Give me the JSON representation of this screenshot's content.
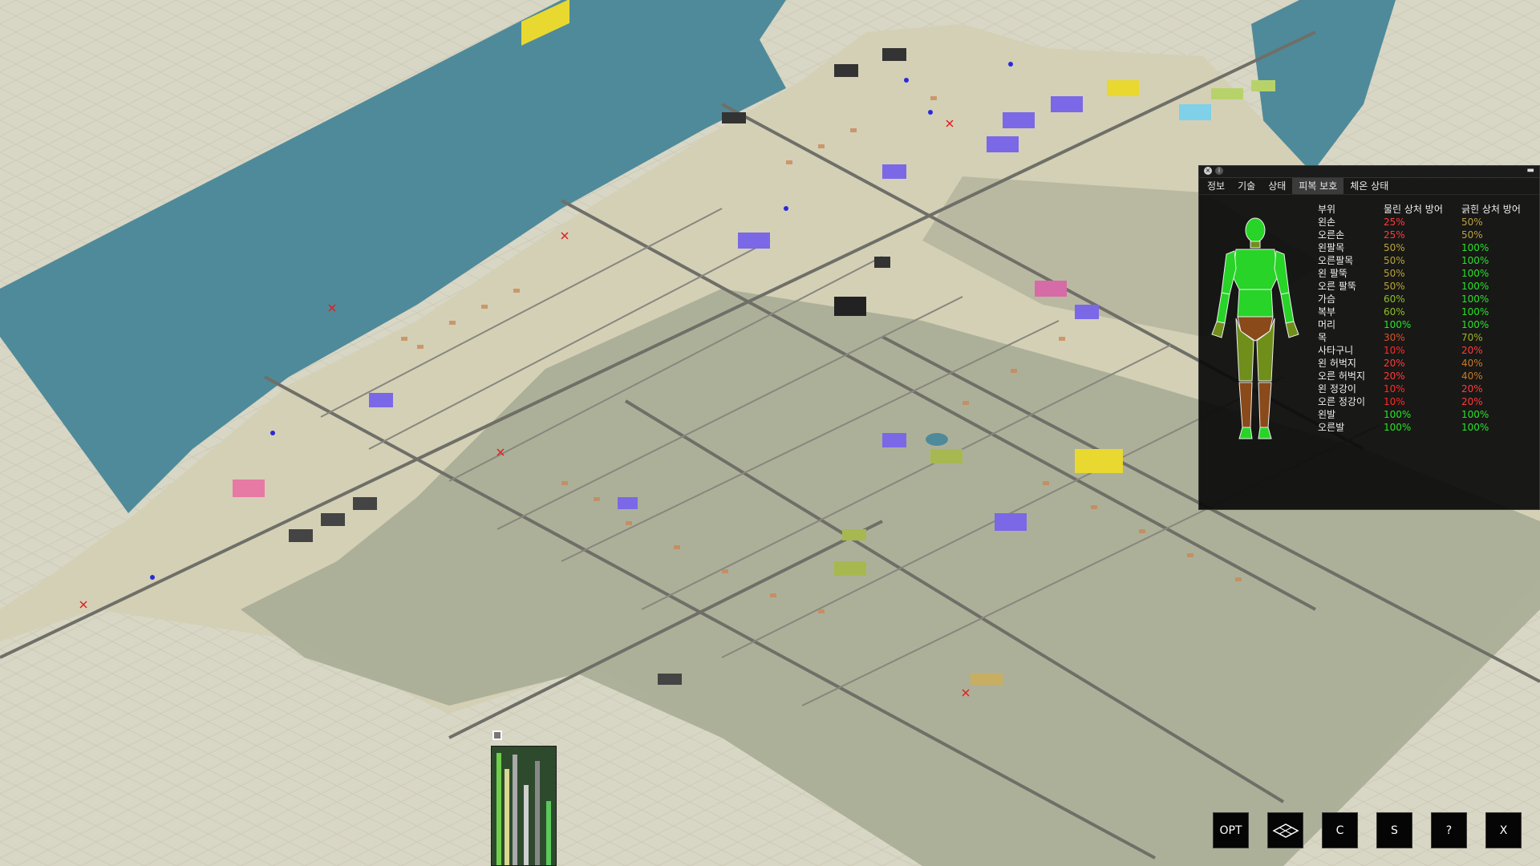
{
  "panel": {
    "tabs": [
      "정보",
      "기술",
      "상태",
      "피복 보호",
      "체온 상태"
    ],
    "active_tab": 3,
    "headers": {
      "part": "부위",
      "bite": "물린 상처 방어",
      "scratch": "긁힌 상처 방어"
    },
    "rows": [
      {
        "part": "왼손",
        "bite": "25%",
        "scratch": "50%",
        "bite_color": "#ff3b3b",
        "scratch_color": "#b9a33a"
      },
      {
        "part": "오른손",
        "bite": "25%",
        "scratch": "50%",
        "bite_color": "#ff3b3b",
        "scratch_color": "#b9a33a"
      },
      {
        "part": "왼팔목",
        "bite": "50%",
        "scratch": "100%",
        "bite_color": "#b9a33a",
        "scratch_color": "#29e329"
      },
      {
        "part": "오른팔목",
        "bite": "50%",
        "scratch": "100%",
        "bite_color": "#b9a33a",
        "scratch_color": "#29e329"
      },
      {
        "part": "왼 팔뚝",
        "bite": "50%",
        "scratch": "100%",
        "bite_color": "#b9a33a",
        "scratch_color": "#29e329"
      },
      {
        "part": "오른 팔뚝",
        "bite": "50%",
        "scratch": "100%",
        "bite_color": "#b9a33a",
        "scratch_color": "#29e329"
      },
      {
        "part": "가슴",
        "bite": "60%",
        "scratch": "100%",
        "bite_color": "#8fbf2a",
        "scratch_color": "#29e329"
      },
      {
        "part": "복부",
        "bite": "60%",
        "scratch": "100%",
        "bite_color": "#8fbf2a",
        "scratch_color": "#29e329"
      },
      {
        "part": "머리",
        "bite": "100%",
        "scratch": "100%",
        "bite_color": "#29e329",
        "scratch_color": "#29e329"
      },
      {
        "part": "목",
        "bite": "30%",
        "scratch": "70%",
        "bite_color": "#d9532a",
        "scratch_color": "#9fb32a"
      },
      {
        "part": "사타구니",
        "bite": "10%",
        "scratch": "20%",
        "bite_color": "#ff2a2a",
        "scratch_color": "#ff3b3b"
      },
      {
        "part": "왼 허벅지",
        "bite": "20%",
        "scratch": "40%",
        "bite_color": "#ff3b3b",
        "scratch_color": "#c97a2a"
      },
      {
        "part": "오른 허벅지",
        "bite": "20%",
        "scratch": "40%",
        "bite_color": "#ff3b3b",
        "scratch_color": "#c97a2a"
      },
      {
        "part": "왼 정강이",
        "bite": "10%",
        "scratch": "20%",
        "bite_color": "#ff2a2a",
        "scratch_color": "#ff3b3b"
      },
      {
        "part": "오른 정강이",
        "bite": "10%",
        "scratch": "20%",
        "bite_color": "#ff2a2a",
        "scratch_color": "#ff3b3b"
      },
      {
        "part": "왼발",
        "bite": "100%",
        "scratch": "100%",
        "bite_color": "#29e329",
        "scratch_color": "#29e329"
      },
      {
        "part": "오른발",
        "bite": "100%",
        "scratch": "100%",
        "bite_color": "#29e329",
        "scratch_color": "#29e329"
      }
    ]
  },
  "buttons": {
    "opt": "OPT",
    "layers_icon": "layers-icon",
    "c": "C",
    "s": "S",
    "help": "?",
    "close": "X"
  },
  "colors": {
    "water": "#4f8a9a",
    "ground": "#d8d6c4",
    "road": "#7a7a72",
    "forest": "#9da58e",
    "body_green": "#27d427",
    "body_olive": "#6f8f1a",
    "body_brown": "#8a4a1a"
  }
}
